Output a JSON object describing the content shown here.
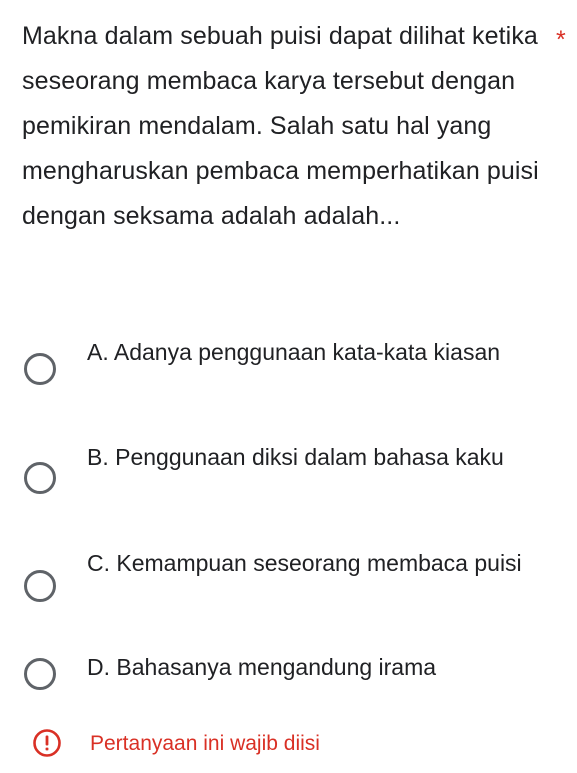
{
  "question": {
    "text": "Makna dalam sebuah puisi dapat dilihat ketika seseorang membaca karya tersebut dengan pemikiran mendalam. Salah satu hal yang mengharuskan pembaca memperhatikan puisi dengan seksama adalah adalah...",
    "required_marker": "*"
  },
  "options": [
    {
      "label": "A. Adanya penggunaan kata-kata kiasan",
      "selected": false
    },
    {
      "label": "B. Penggunaan diksi dalam bahasa kaku",
      "selected": false
    },
    {
      "label": "C. Kemampuan seseorang membaca puisi",
      "selected": false
    },
    {
      "label": "D. Bahasanya mengandung irama",
      "selected": false
    }
  ],
  "validation": {
    "message": "Pertanyaan ini wajib diisi",
    "icon": "alert-circle-icon"
  },
  "colors": {
    "text": "#202124",
    "required": "#d93025",
    "radio_border": "#5f6368",
    "error": "#d93025"
  }
}
